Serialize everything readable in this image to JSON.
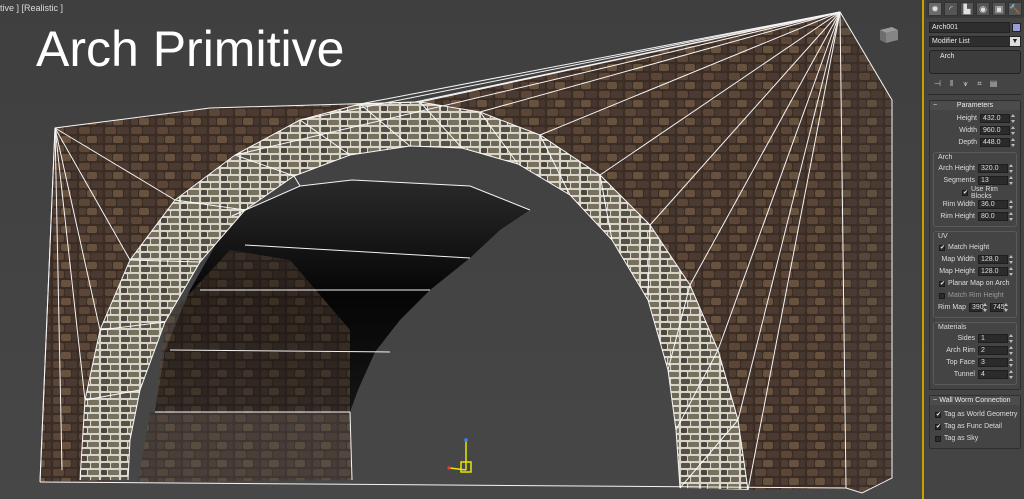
{
  "viewport": {
    "label_left": "tive ]",
    "label_right": "[Realistic ]",
    "overlay_title": "Arch Primitive"
  },
  "command_panel": {
    "tabs": [
      {
        "icon": "create-icon",
        "glyph": "✹",
        "active": true
      },
      {
        "icon": "modify-icon",
        "glyph": "◜",
        "active": false
      },
      {
        "icon": "hierarchy-icon",
        "glyph": "▙",
        "active": false
      },
      {
        "icon": "motion-icon",
        "glyph": "◉",
        "active": false
      },
      {
        "icon": "display-icon",
        "glyph": "▣",
        "active": false
      },
      {
        "icon": "utilities-icon",
        "glyph": "🔨",
        "active": false
      }
    ],
    "object_name": "Arch001",
    "object_color": "#9b9cd8",
    "modifier_list_label": "Modifier List",
    "stack_item": "Arch",
    "stack_tools": [
      "⊣",
      "‖",
      "⩛",
      "⌗",
      "▤"
    ]
  },
  "parameters": {
    "title": "Parameters",
    "height": {
      "label": "Height",
      "value": "432.0"
    },
    "width": {
      "label": "Width",
      "value": "960.0"
    },
    "depth": {
      "label": "Depth",
      "value": "448.0"
    },
    "arch": {
      "title": "Arch",
      "arch_height": {
        "label": "Arch Height",
        "value": "320.0"
      },
      "segments": {
        "label": "Segments",
        "value": "13"
      },
      "use_rim_blocks": {
        "label": "Use Rim Blocks",
        "checked": true
      },
      "rim_width": {
        "label": "Rim Width",
        "value": "36.0"
      },
      "rim_height": {
        "label": "Rim Height",
        "value": "80.0"
      }
    },
    "uv": {
      "title": "UV",
      "match_height": {
        "label": "Match Height",
        "checked": true
      },
      "map_width": {
        "label": "Map Width",
        "value": "128.0"
      },
      "map_height": {
        "label": "Map Height",
        "value": "128.0"
      },
      "planar_map_on_arch": {
        "label": "Planar Map on Arch",
        "checked": true
      },
      "match_rim_height": {
        "label": "Match Rim Height",
        "checked": false
      },
      "rim_map": {
        "label": "Rim Map",
        "value_a": "390.",
        "value_b": "745."
      }
    },
    "materials": {
      "title": "Materials",
      "sides": {
        "label": "Sides",
        "value": "1"
      },
      "arch_rim": {
        "label": "Arch Rim",
        "value": "2"
      },
      "top_face": {
        "label": "Top Face",
        "value": "3"
      },
      "tunnel": {
        "label": "Tunnel",
        "value": "4"
      }
    }
  },
  "wallworm": {
    "title": "Wall Worm Connection",
    "tag_world_geometry": {
      "label": "Tag as World Geometry",
      "checked": true
    },
    "tag_func_detail": {
      "label": "Tag as Func Detail",
      "checked": true
    },
    "tag_sky": {
      "label": "Tag as Sky",
      "checked": false
    }
  },
  "colors": {
    "viewport_border": "#c8a000",
    "wire": "#ffffff",
    "stone_dark": "#3a2a22",
    "stone_mid": "#5a4538",
    "rim_stone": "#6a6a62",
    "gizmo": "#e6e600"
  }
}
